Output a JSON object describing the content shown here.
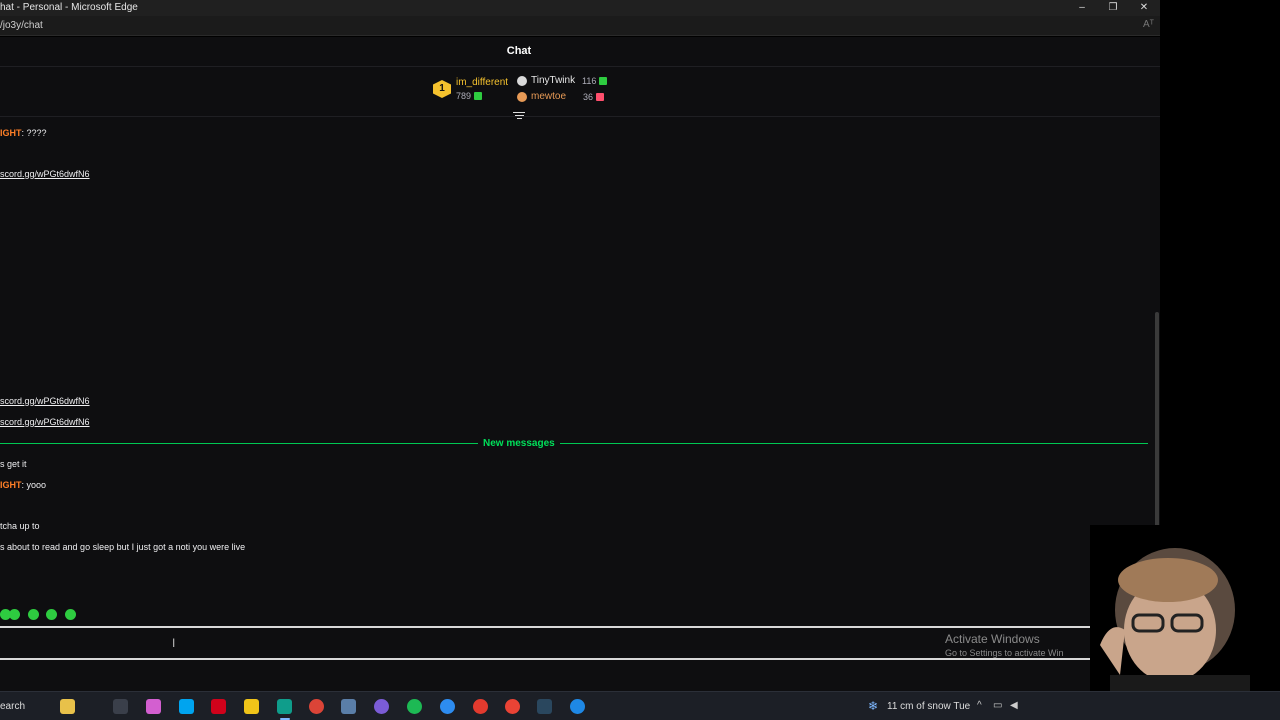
{
  "window": {
    "title": "hat - Personal - Microsoft Edge",
    "url": "/jo3y/chat",
    "minimize": "–",
    "restore": "❐",
    "close": "✕",
    "read_aloud": "Aᵀ"
  },
  "chat": {
    "title": "Chat",
    "leaderboard": {
      "first": {
        "rank": "1",
        "name": "im_different",
        "points": "789"
      },
      "second": {
        "name": "TinyTwink",
        "points": "116"
      },
      "third": {
        "name": "mewtoe",
        "points": "36"
      }
    },
    "messages_top": [
      {
        "user": "IGHT",
        "text": ": ????"
      },
      {
        "link": "scord.gg/wPGt6dwfN6"
      },
      {
        "link": "scord.gg/wPGt6dwfN6"
      },
      {
        "link": "scord.gg/wPGt6dwfN6"
      }
    ],
    "new_messages_label": "New messages",
    "messages_new": [
      {
        "text": "s get it"
      },
      {
        "user": "IGHT",
        "text": ": yooo"
      },
      {
        "text": "tcha up to"
      },
      {
        "text": "s about to read and go sleep but I just got a noti you were live"
      }
    ],
    "input_caret": "I"
  },
  "watermark": {
    "line1": "Activate Windows",
    "line2": "Go to Settings to activate Win"
  },
  "taskbar": {
    "search": "earch",
    "weather": "11 cm of snow Tue",
    "chevron": "^"
  },
  "colors": {
    "accent_green": "#00e05a",
    "username_orange": "#ff7f27",
    "gold": "#f5c22e"
  }
}
